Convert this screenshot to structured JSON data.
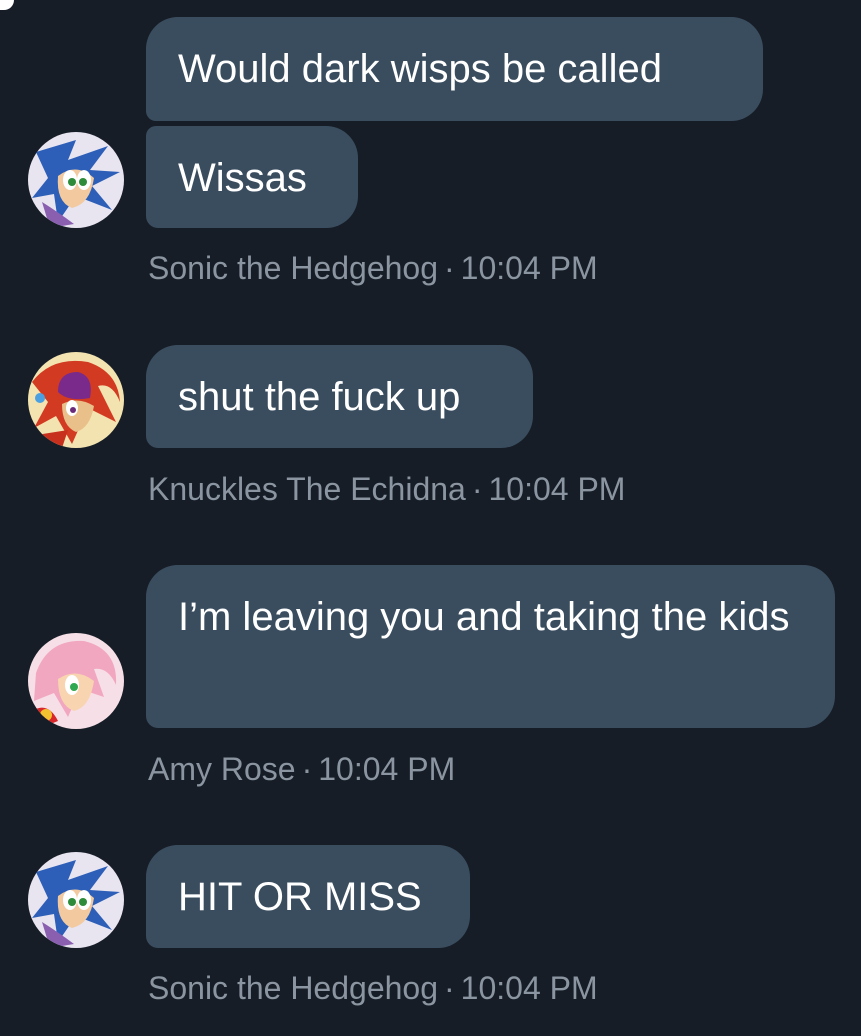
{
  "messages": [
    {
      "sender": "Sonic the Hedgehog",
      "time": "10:04 PM",
      "separator": "·",
      "avatar_icon": "sonic-avatar-icon",
      "bubbles": [
        "Would dark wisps be called",
        "Wissas"
      ]
    },
    {
      "sender": "Knuckles The Echidna",
      "time": "10:04 PM",
      "separator": "·",
      "avatar_icon": "knuckles-avatar-icon",
      "bubbles": [
        "shut the fuck up"
      ]
    },
    {
      "sender": "Amy Rose",
      "time": "10:04 PM",
      "separator": "·",
      "avatar_icon": "amy-avatar-icon",
      "bubbles": [
        "I’m leaving you and taking the kids"
      ]
    },
    {
      "sender": "Sonic the Hedgehog",
      "time": "10:04 PM",
      "separator": "·",
      "avatar_icon": "sonic-avatar-icon",
      "bubbles": [
        "HIT OR MISS"
      ]
    }
  ],
  "colors": {
    "background": "#161d26",
    "bubble": "#3a4d5f",
    "bubble_text": "#ffffff",
    "meta_text": "#8a95a1"
  }
}
